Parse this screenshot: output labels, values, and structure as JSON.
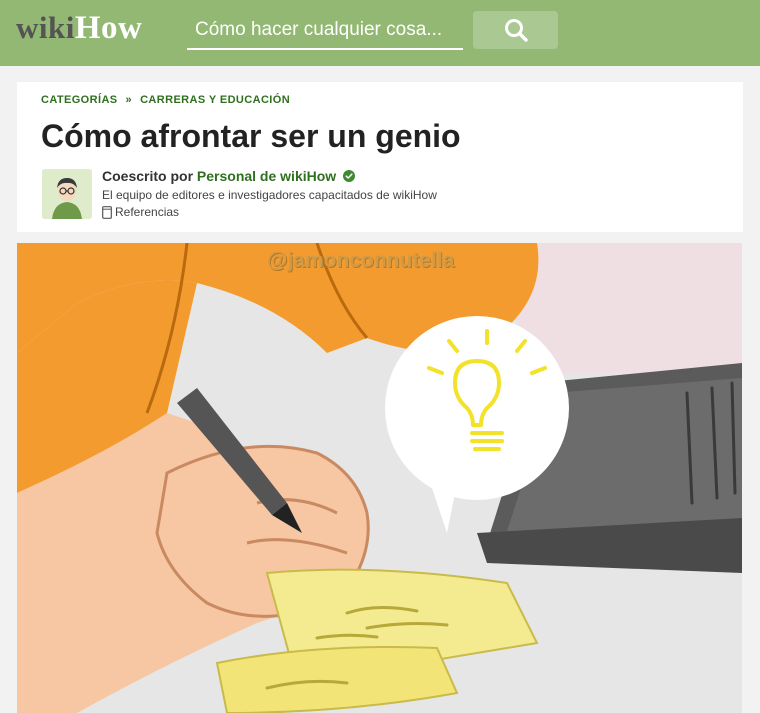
{
  "header": {
    "logo_left": "wiki",
    "logo_right": "How",
    "search_placeholder": "Cómo hacer cualquier cosa...",
    "search_icon": "search-icon",
    "bg_color": "#93b874"
  },
  "breadcrumb": {
    "items": [
      "CATEGORÍAS",
      "CARRERAS Y EDUCACIÓN"
    ],
    "separator": "»"
  },
  "article": {
    "title": "Cómo afrontar ser un genio",
    "byline_prefix": "Coescrito por",
    "author": "Personal de wikiHow",
    "team_description": "El equipo de editores e investigadores capacitados de wikiHow",
    "references_label": "Referencias"
  },
  "illustration": {
    "watermark": "@jamonconnutella",
    "accent_color": "#f39b2f",
    "bulb_color": "#f2e22a"
  }
}
